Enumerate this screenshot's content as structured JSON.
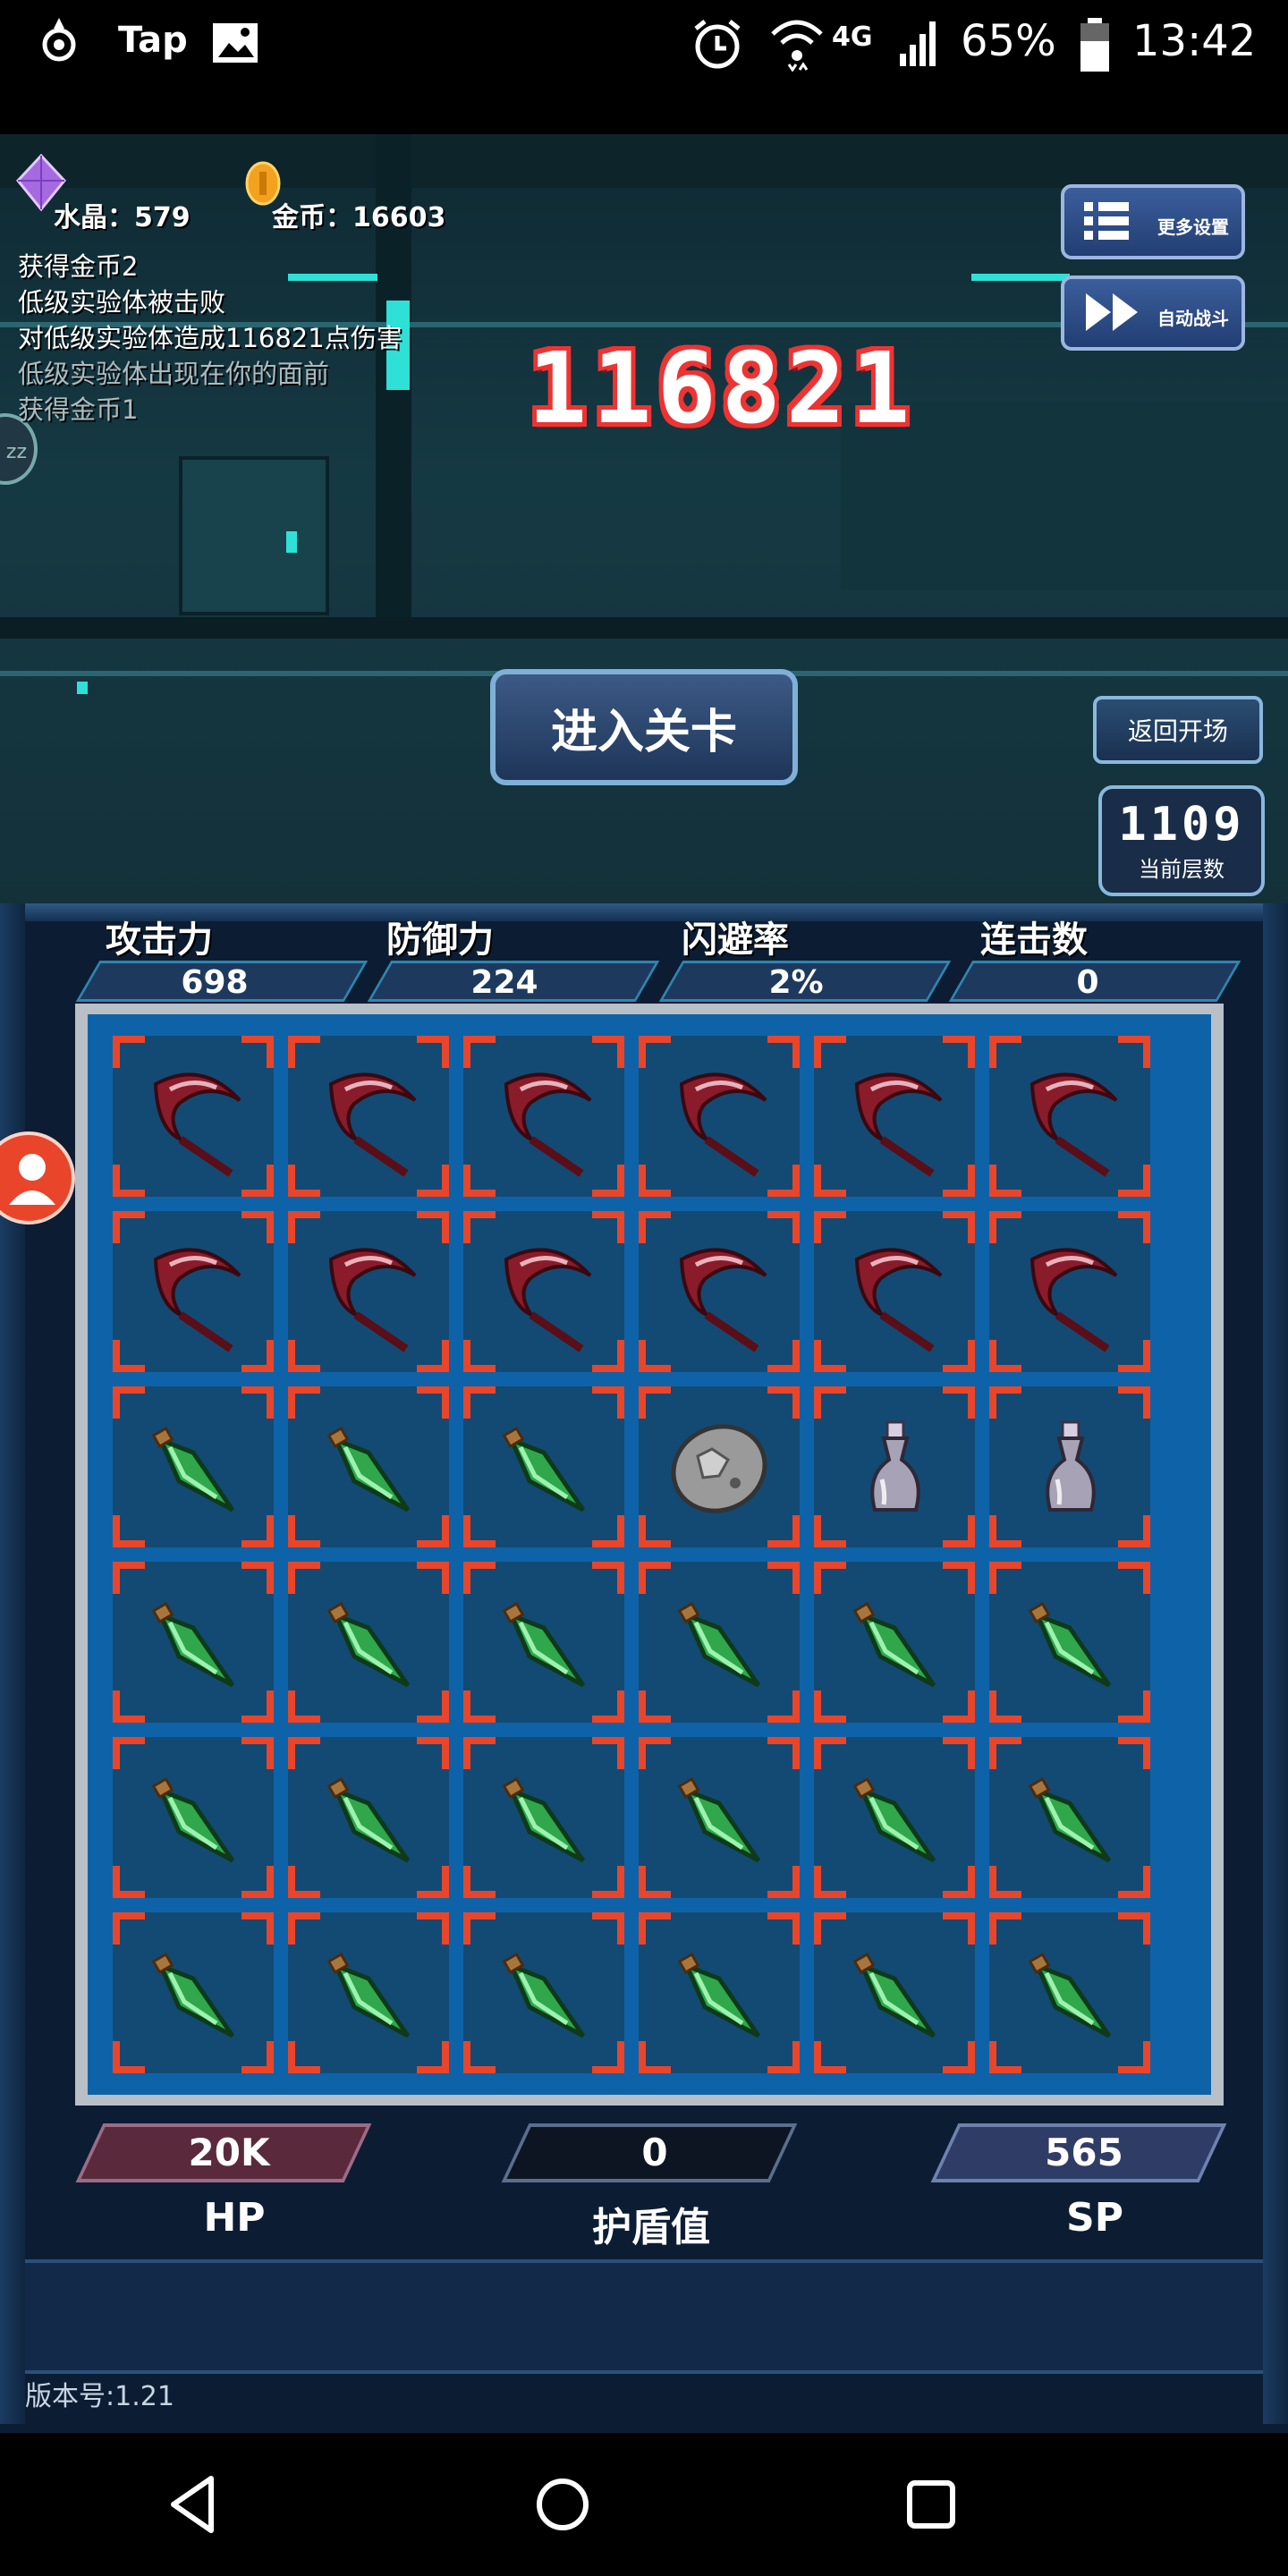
{
  "status_bar": {
    "app_label": "Tap",
    "network": "4G",
    "battery": "65%",
    "time": "13:42"
  },
  "resources": {
    "crystal": "水晶：579",
    "gold": "金币：16603"
  },
  "battle_log": [
    "获得金币2",
    "低级实验体被击败",
    "对低级实验体造成116821点伤害",
    "低级实验体出现在你的面前",
    "获得金币1"
  ],
  "damage_number": "116821",
  "buttons": {
    "more_settings": "更多设置",
    "auto_battle": "自动战斗",
    "enter_stage": "进入关卡",
    "back_to_start": "返回开场"
  },
  "floor": {
    "value": "1109",
    "label": "当前层数"
  },
  "stats": [
    {
      "label": "攻击力",
      "value": "698"
    },
    {
      "label": "防御力",
      "value": "224"
    },
    {
      "label": "闪避率",
      "value": "2%"
    },
    {
      "label": "连击数",
      "value": "0"
    }
  ],
  "inventory_grid": {
    "rows": 6,
    "cols": 6,
    "items": [
      "scythe-icon",
      "scythe-icon",
      "scythe-icon",
      "scythe-icon",
      "scythe-icon",
      "scythe-icon",
      "scythe-icon",
      "scythe-icon",
      "scythe-icon",
      "scythe-icon",
      "scythe-icon",
      "scythe-icon",
      "green-crystal-icon",
      "green-crystal-icon",
      "green-crystal-icon",
      "stone-icon",
      "silver-bottle-icon",
      "silver-bottle-icon",
      "green-crystal-icon",
      "green-crystal-icon",
      "green-crystal-icon",
      "green-crystal-icon",
      "green-crystal-icon",
      "green-crystal-icon",
      "green-crystal-icon",
      "green-crystal-icon",
      "green-crystal-icon",
      "green-crystal-icon",
      "green-crystal-icon",
      "green-crystal-icon",
      "green-crystal-icon",
      "green-crystal-icon",
      "green-crystal-icon",
      "green-crystal-icon",
      "green-crystal-icon",
      "green-crystal-icon"
    ]
  },
  "bars": [
    {
      "label": "HP",
      "value": "20K",
      "color": "#5a2a3c"
    },
    {
      "label": "护盾值",
      "value": "0",
      "color": "#0d1522"
    },
    {
      "label": "SP",
      "value": "565",
      "color": "#2f3d66"
    }
  ],
  "version": "版本号:1.21",
  "colors": {
    "frame_red": "#e8452a",
    "grid_blue": "#0e63a8",
    "panel_dark": "#0c1d33"
  }
}
